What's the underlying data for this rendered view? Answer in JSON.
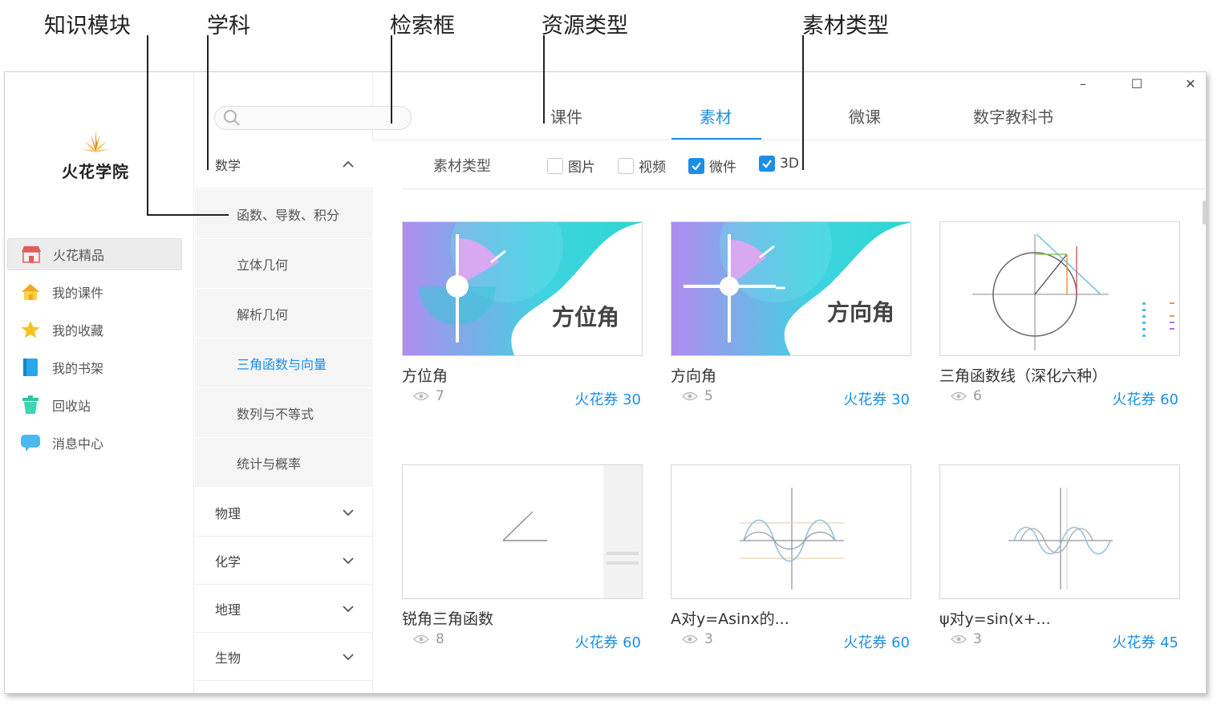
{
  "annotations": {
    "knowledge_module": "知识模块",
    "subject": "学科",
    "search_box": "检索框",
    "resource_type": "资源类型",
    "material_type": "素材类型"
  },
  "window_controls": {
    "minimize": "–",
    "maximize": "☐",
    "close": "✕"
  },
  "app": {
    "logo_text": "火花学院"
  },
  "nav": [
    {
      "label": "火花精品",
      "icon": "shop-icon",
      "active": true
    },
    {
      "label": "我的课件",
      "icon": "home-icon"
    },
    {
      "label": "我的收藏",
      "icon": "star-icon"
    },
    {
      "label": "我的书架",
      "icon": "book-icon"
    },
    {
      "label": "回收站",
      "icon": "trash-icon"
    },
    {
      "label": "消息中心",
      "icon": "message-icon"
    }
  ],
  "search": {
    "placeholder": ""
  },
  "subjects": [
    {
      "label": "数学",
      "expanded": true
    },
    {
      "label": "物理"
    },
    {
      "label": "化学"
    },
    {
      "label": "地理"
    },
    {
      "label": "生物"
    }
  ],
  "modules": [
    {
      "label": "函数、导数、积分"
    },
    {
      "label": "立体几何"
    },
    {
      "label": "解析几何"
    },
    {
      "label": "三角函数与向量",
      "active": true
    },
    {
      "label": "数列与不等式"
    },
    {
      "label": "统计与概率"
    }
  ],
  "tabs": [
    {
      "label": "课件"
    },
    {
      "label": "素材",
      "active": true
    },
    {
      "label": "微课"
    },
    {
      "label": "数字教科书"
    }
  ],
  "filter": {
    "label": "素材类型",
    "options": [
      {
        "label": "图片",
        "checked": false
      },
      {
        "label": "视频",
        "checked": false
      },
      {
        "label": "微件",
        "checked": true
      },
      {
        "label": "3D",
        "checked": true
      }
    ]
  },
  "cards": [
    {
      "title": "方位角",
      "thumb_text": "方位角",
      "views": "7",
      "price": "火花券 30"
    },
    {
      "title": "方向角",
      "thumb_text": "方向角",
      "views": "5",
      "price": "火花券 30"
    },
    {
      "title": "三角函数线（深化六种）",
      "views": "6",
      "price": "火花券 60"
    },
    {
      "title": "锐角三角函数",
      "views": "8",
      "price": "火花券 60"
    },
    {
      "title": "A对y=Asinx的...",
      "views": "3",
      "price": "火花券 60"
    },
    {
      "title": "ψ对y=sin(x+...",
      "views": "3",
      "price": "火花券 45"
    }
  ],
  "colors": {
    "accent": "#1a8fe6",
    "thumb_gradient_start": "#a98af0",
    "thumb_gradient_end": "#2fd6d8"
  }
}
